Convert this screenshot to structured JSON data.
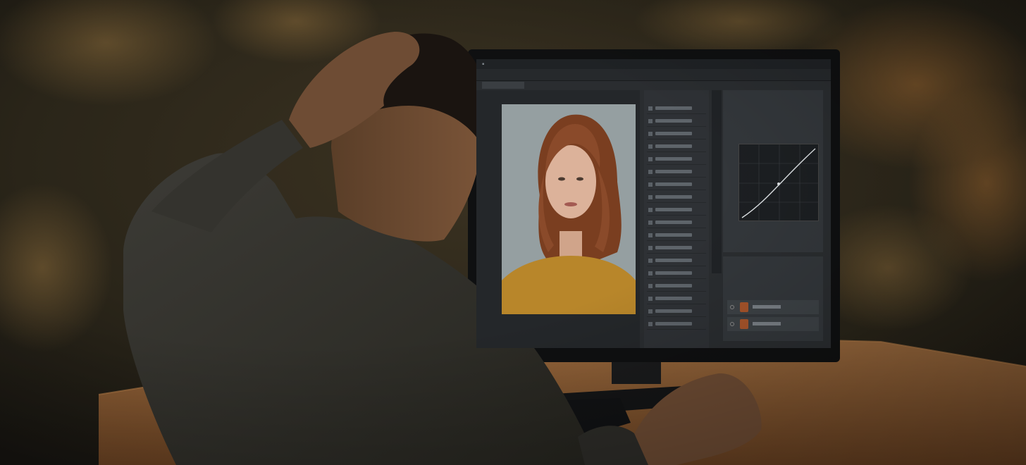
{
  "scene": {
    "background_color": "#2b2619",
    "desk_color": "#8a5a34",
    "sweater_color": "#353430",
    "skin_color": "#6a4a32",
    "screen_accent": "#2a2d30",
    "portrait_hair_color": "#8a4a2a",
    "portrait_top_color": "#b8862a"
  },
  "subjects": {
    "man": "man-at-computer",
    "monitor": "computer-monitor",
    "portrait": "woman-portrait",
    "keyboard": "keyboard"
  }
}
